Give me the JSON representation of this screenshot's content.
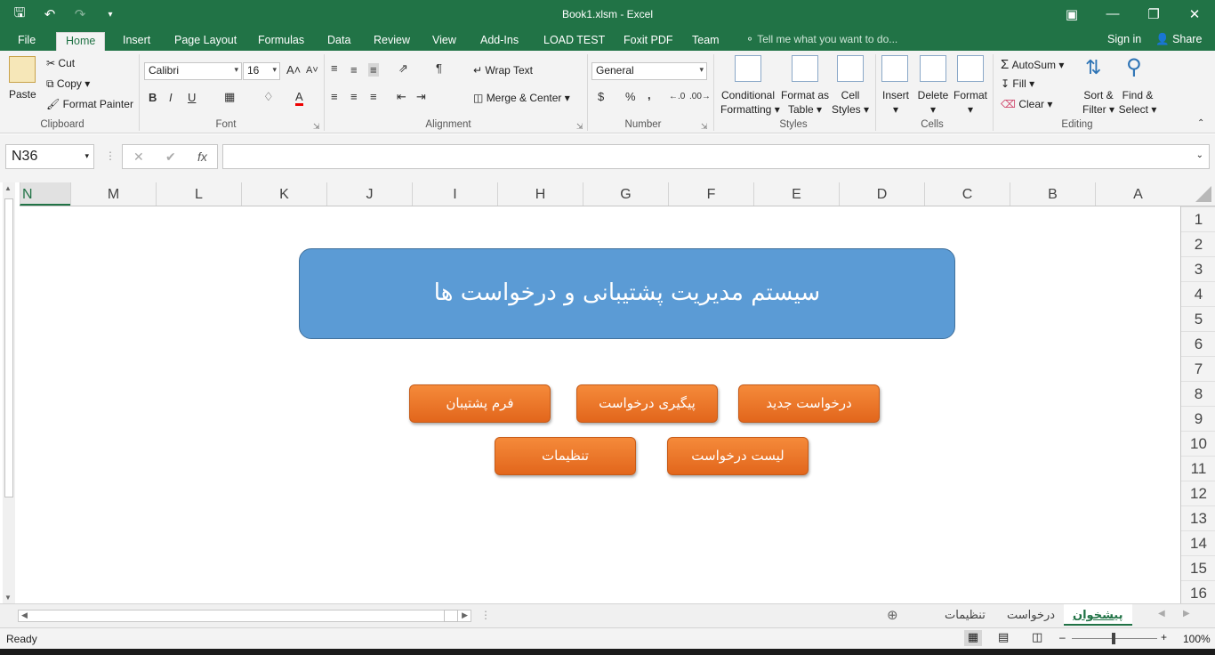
{
  "window": {
    "title": "Book1.xlsm - Excel"
  },
  "ribbon_tabs": [
    {
      "label": "File"
    },
    {
      "label": "Home"
    },
    {
      "label": "Insert"
    },
    {
      "label": "Page Layout"
    },
    {
      "label": "Formulas"
    },
    {
      "label": "Data"
    },
    {
      "label": "Review"
    },
    {
      "label": "View"
    },
    {
      "label": "Add-Ins"
    },
    {
      "label": "LOAD TEST"
    },
    {
      "label": "Foxit PDF"
    },
    {
      "label": "Team"
    }
  ],
  "tell_me": "Tell me what you want to do...",
  "account": {
    "signin": "Sign in",
    "share": "Share"
  },
  "clipboard": {
    "paste": "Paste",
    "cut": "Cut",
    "copy": "Copy",
    "format_painter": "Format Painter",
    "label": "Clipboard"
  },
  "font": {
    "name": "Calibri",
    "size": "16",
    "label": "Font",
    "bold": "B",
    "italic": "I",
    "underline": "U"
  },
  "alignment": {
    "wrap": "Wrap Text",
    "merge": "Merge & Center",
    "label": "Alignment"
  },
  "number": {
    "format": "General",
    "currency": "$",
    "percent": "%",
    "comma": ",",
    "label": "Number"
  },
  "styles": {
    "conditional": "Conditional",
    "conditional2": "Formatting",
    "format_as": "Format as",
    "format_as2": "Table",
    "cell": "Cell",
    "cell2": "Styles",
    "label": "Styles"
  },
  "cells": {
    "insert": "Insert",
    "delete": "Delete",
    "format": "Format",
    "label": "Cells"
  },
  "editing": {
    "autosum": "AutoSum",
    "fill": "Fill",
    "clear": "Clear",
    "sort": "Sort &",
    "sort2": "Filter",
    "find": "Find &",
    "find2": "Select",
    "label": "Editing"
  },
  "formula_bar": {
    "name_box": "N36",
    "fx": "fx",
    "formula": ""
  },
  "columns": [
    "N",
    "M",
    "L",
    "K",
    "J",
    "I",
    "H",
    "G",
    "F",
    "E",
    "D",
    "C",
    "B",
    "A"
  ],
  "rows": [
    "1",
    "2",
    "3",
    "4",
    "5",
    "6",
    "7",
    "8",
    "9",
    "10",
    "11",
    "12",
    "13",
    "14",
    "15",
    "16"
  ],
  "sheet_content": {
    "banner": "سیستم مدیریت پشتیبانی و درخواست ها",
    "buttons": {
      "new_request": "درخواست جدید",
      "track_request": "پیگیری درخواست",
      "support_form": "فرم پشتیبان",
      "request_list": "لیست درخواست",
      "settings": "تنظیمات"
    }
  },
  "sheet_tabs": [
    {
      "label": "پیشخوان",
      "active": true
    },
    {
      "label": "درخواست",
      "active": false
    },
    {
      "label": "تنظیمات",
      "active": false
    }
  ],
  "status": {
    "ready": "Ready",
    "zoom": "100%"
  },
  "colors": {
    "excel_green": "#217346",
    "banner_blue": "#5b9bd5",
    "button_orange": "#ed7d31"
  }
}
